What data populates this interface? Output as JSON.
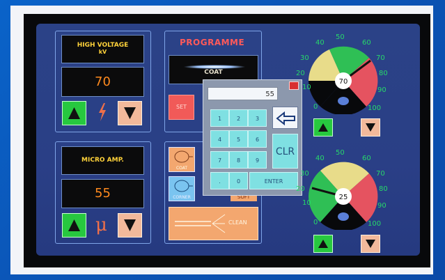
{
  "high_voltage": {
    "label_line1": "HIGH VOLTAGE",
    "label_line2": "kV",
    "value": "70",
    "icon": "lightning-icon"
  },
  "micro_amp": {
    "label": "MICRO AMP.",
    "value": "55",
    "icon": "mu-icon"
  },
  "programme": {
    "title": "PROGRAMME",
    "selected": "COAT",
    "set_label": "SET",
    "coat_label": "COAT",
    "corner_label": "CORNER",
    "soft_label": "SOFT",
    "clean_label": "CLEAN"
  },
  "keypad": {
    "display": "55",
    "keys": [
      "1",
      "2",
      "3",
      "4",
      "5",
      "6",
      "7",
      "8",
      "9",
      ".",
      "0"
    ],
    "clear_label": "CLR",
    "enter_label": "ENTER",
    "backspace_icon": "backspace-arrow-icon"
  },
  "gauge_kv": {
    "value": "70",
    "ticks": [
      "0",
      "10",
      "20",
      "30",
      "40",
      "50",
      "60",
      "70",
      "80",
      "90",
      "100"
    ]
  },
  "gauge_ua": {
    "value": "25",
    "ticks": [
      "0",
      "10",
      "20",
      "30",
      "40",
      "50",
      "60",
      "70",
      "80",
      "90",
      "100"
    ]
  },
  "colors": {
    "screen": "#2a3f86",
    "amber": "#ffd23a",
    "orange": "#ff8a1e",
    "green": "#27c83f",
    "salmon": "#f2b99b",
    "red": "#e84a4a",
    "gauge_green": "#2fbf55",
    "gauge_yellow": "#e8dc8a",
    "gauge_red": "#e55360"
  }
}
